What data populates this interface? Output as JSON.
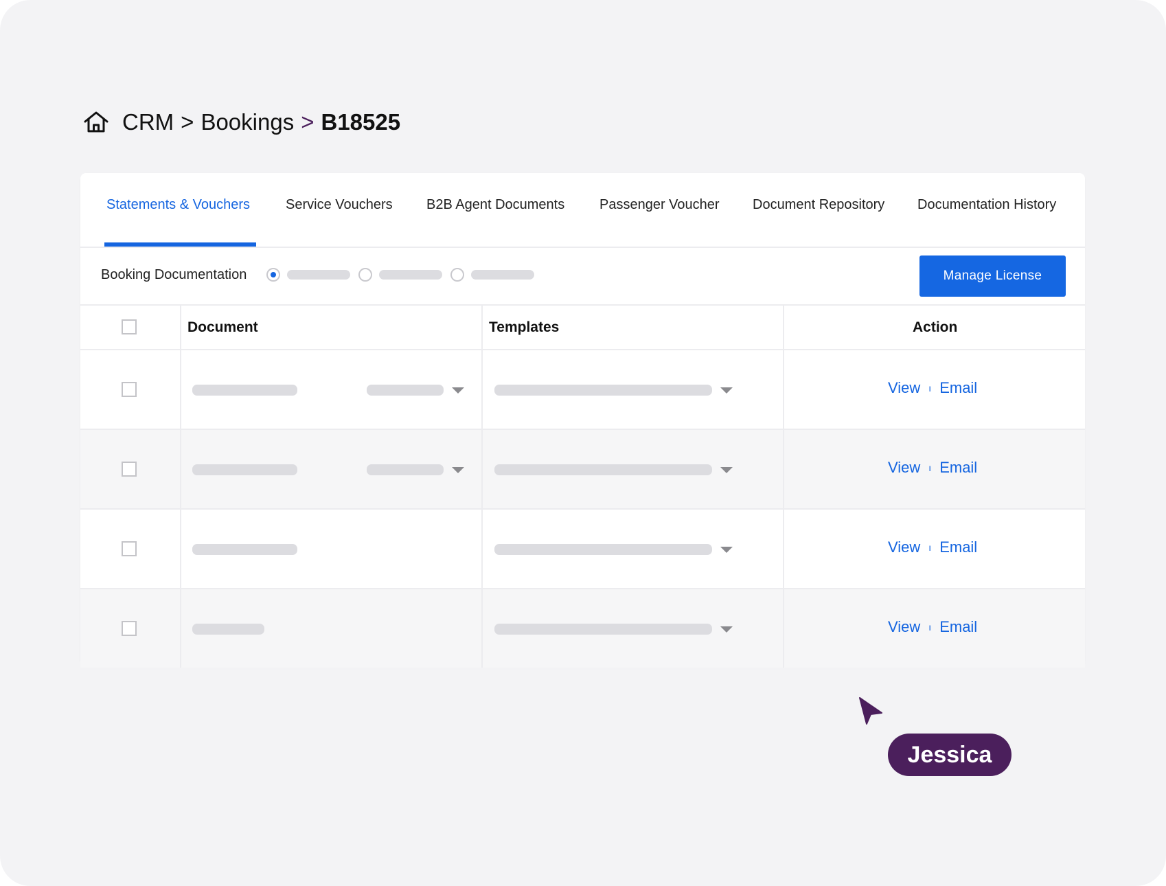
{
  "breadcrumb": {
    "items": [
      "CRM",
      "Bookings"
    ],
    "separators": [
      ">",
      ">"
    ],
    "current": "B18525",
    "home_icon": "home-icon"
  },
  "tabs": [
    {
      "label": "Statements & Vouchers",
      "active": true
    },
    {
      "label": "Service Vouchers",
      "active": false
    },
    {
      "label": "B2B Agent Documents",
      "active": false
    },
    {
      "label": "Passenger Voucher",
      "active": false
    },
    {
      "label": "Document Repository",
      "active": false
    },
    {
      "label": "Documentation History",
      "active": false
    }
  ],
  "toolbar": {
    "label": "Booking Documentation",
    "radio_options": [
      {
        "checked": true
      },
      {
        "checked": false
      },
      {
        "checked": false
      }
    ],
    "manage_license_label": "Manage License"
  },
  "table": {
    "columns": [
      "Document",
      "Templates",
      "Action"
    ],
    "rows": [
      {
        "view_label": "View",
        "divider": "ı",
        "email_label": "Email"
      },
      {
        "view_label": "View",
        "divider": "ı",
        "email_label": "Email"
      },
      {
        "view_label": "View",
        "divider": "ı",
        "email_label": "Email"
      },
      {
        "view_label": "View",
        "divider": "ı",
        "email_label": "Email"
      }
    ]
  },
  "collaborator": {
    "name": "Jessica",
    "color": "#4b1f5c"
  },
  "colors": {
    "accent": "#1565e0",
    "button": "#1567e2",
    "background": "#f3f3f5",
    "placeholder": "#dcdce0"
  }
}
